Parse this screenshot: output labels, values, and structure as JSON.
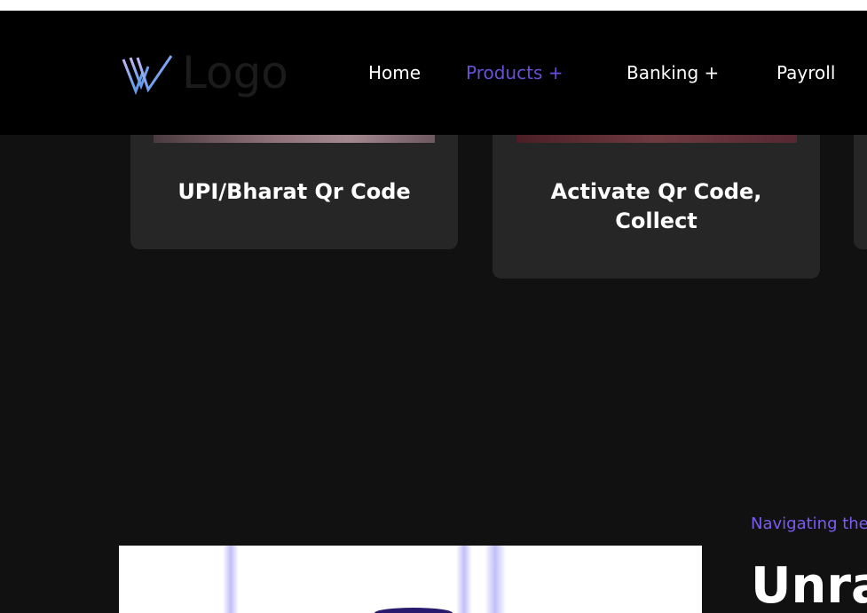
{
  "header": {
    "logo_text": "Logo",
    "nav": [
      {
        "label": "Home",
        "active": false
      },
      {
        "label": "Products +",
        "active": true
      },
      {
        "label": "Banking +",
        "active": false
      },
      {
        "label": "Payroll",
        "active": false
      }
    ]
  },
  "cards": [
    {
      "title": "UPI/Bharat Qr Code"
    },
    {
      "title": "Activate Qr Code, Collect"
    }
  ],
  "section": {
    "subheading": "Navigating the",
    "heading": "Unra"
  },
  "colors": {
    "accent": "#6b4fd8",
    "page_bg": "#111111",
    "header_bg": "#000000",
    "card_bg": "#262626"
  },
  "icons": {
    "logo_mark": "w-logo-icon"
  }
}
